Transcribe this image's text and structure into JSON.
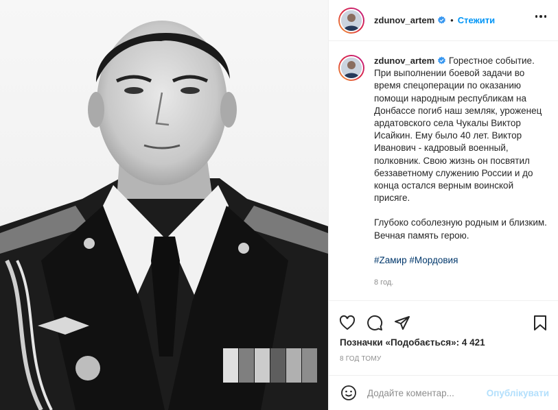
{
  "post": {
    "username": "zdunov_artem",
    "follow_label": "Стежити",
    "separator": "•",
    "caption_lines": [
      "Горестное событие.",
      "При выполнении боевой задачи во время спецоперации по оказанию помощи народным республикам на Донбассе погиб наш земляк, уроженец ардатовского села Чукалы Виктор Исайкин. Ему было 40 лет. Виктор Иванович - кадровый военный, полковник. Свою жизнь он посвятил беззаветному служению России и до конца остался верным воинской присяге.",
      "Глубоко соболезную родным и близким. Вечная память герою."
    ],
    "hashtags": [
      "#Zамир",
      "#Мордовия"
    ],
    "caption_age": "8 год.",
    "likes_label": "Позначки «Подобається»: 4 421",
    "post_time": "8 ГОД ТОМУ",
    "comment_placeholder": "Додайте коментар...",
    "publish_label": "Опублікувати"
  },
  "colors": {
    "verified": "#3897f0",
    "follow": "#0095f6",
    "hashtag": "#00376b",
    "muted": "#8e8e8e",
    "publish_disabled": "#b2dffc"
  },
  "icons": {
    "verified": "verified-badge-icon",
    "more": "more-options-icon",
    "like": "heart-icon",
    "comment": "comment-icon",
    "share": "share-icon",
    "save": "bookmark-icon",
    "emoji": "emoji-icon"
  }
}
